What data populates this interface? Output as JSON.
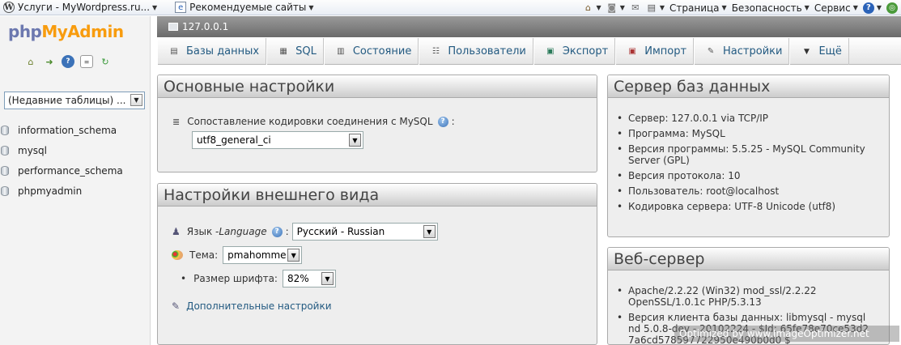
{
  "browser": {
    "favorites": [
      {
        "label": "Услуги - MyWordpress.ru...",
        "icon": "wordpress-icon"
      },
      {
        "label": "Рекомендуемые сайты",
        "icon": "page-icon"
      }
    ],
    "commands": [
      {
        "label": "Страница"
      },
      {
        "label": "Безопасность"
      },
      {
        "label": "Сервис"
      }
    ]
  },
  "sidebar": {
    "logo": {
      "php": "php",
      "my": "My",
      "admin": "Admin"
    },
    "recent_tables": "(Недавние таблицы) ...",
    "databases": [
      "information_schema",
      "mysql",
      "performance_schema",
      "phpmyadmin"
    ]
  },
  "server_bar": {
    "label": "127.0.0.1"
  },
  "tabs": [
    {
      "label": "Базы данных",
      "icon": "database-icon"
    },
    {
      "label": "SQL",
      "icon": "sql-icon"
    },
    {
      "label": "Состояние",
      "icon": "status-icon"
    },
    {
      "label": "Пользователи",
      "icon": "users-icon"
    },
    {
      "label": "Экспорт",
      "icon": "export-icon"
    },
    {
      "label": "Импорт",
      "icon": "import-icon"
    },
    {
      "label": "Настройки",
      "icon": "wrench-icon"
    },
    {
      "label": "Ещё",
      "icon": "chevron-down-icon"
    }
  ],
  "general_settings": {
    "title": "Основные настройки",
    "collation_label": "Сопоставление кодировки соединения с MySQL",
    "collation_value": "utf8_general_ci"
  },
  "appearance": {
    "title": "Настройки внешнего вида",
    "language_label": "Язык - ",
    "language_label_em": "Language",
    "language_value": "Русский - Russian",
    "theme_label": "Тема:",
    "theme_value": "pmahomme",
    "font_label": "Размер шрифта:",
    "font_value": "82%",
    "more_settings": "Дополнительные настройки"
  },
  "db_server": {
    "title": "Сервер баз данных",
    "items": [
      "Сервер: 127.0.0.1 via TCP/IP",
      "Программа: MySQL",
      "Версия программы: 5.5.25 - MySQL Community Server (GPL)",
      "Версия протокола: 10",
      "Пользователь: root@localhost",
      "Кодировка сервера: UTF-8 Unicode (utf8)"
    ]
  },
  "web_server": {
    "title": "Веб-сервер",
    "items": [
      "Apache/2.2.22 (Win32) mod_ssl/2.2.22 OpenSSL/1.0.1c PHP/5.3.13",
      "Версия клиента базы данных: libmysql - mysqlnd 5.0.8-dev - 20102224 - $Id: 65fe78e70ce53d27a6cd578597722950e490b0d0 $"
    ]
  },
  "watermark": "Optimized by www.ImageOptimizer.net"
}
